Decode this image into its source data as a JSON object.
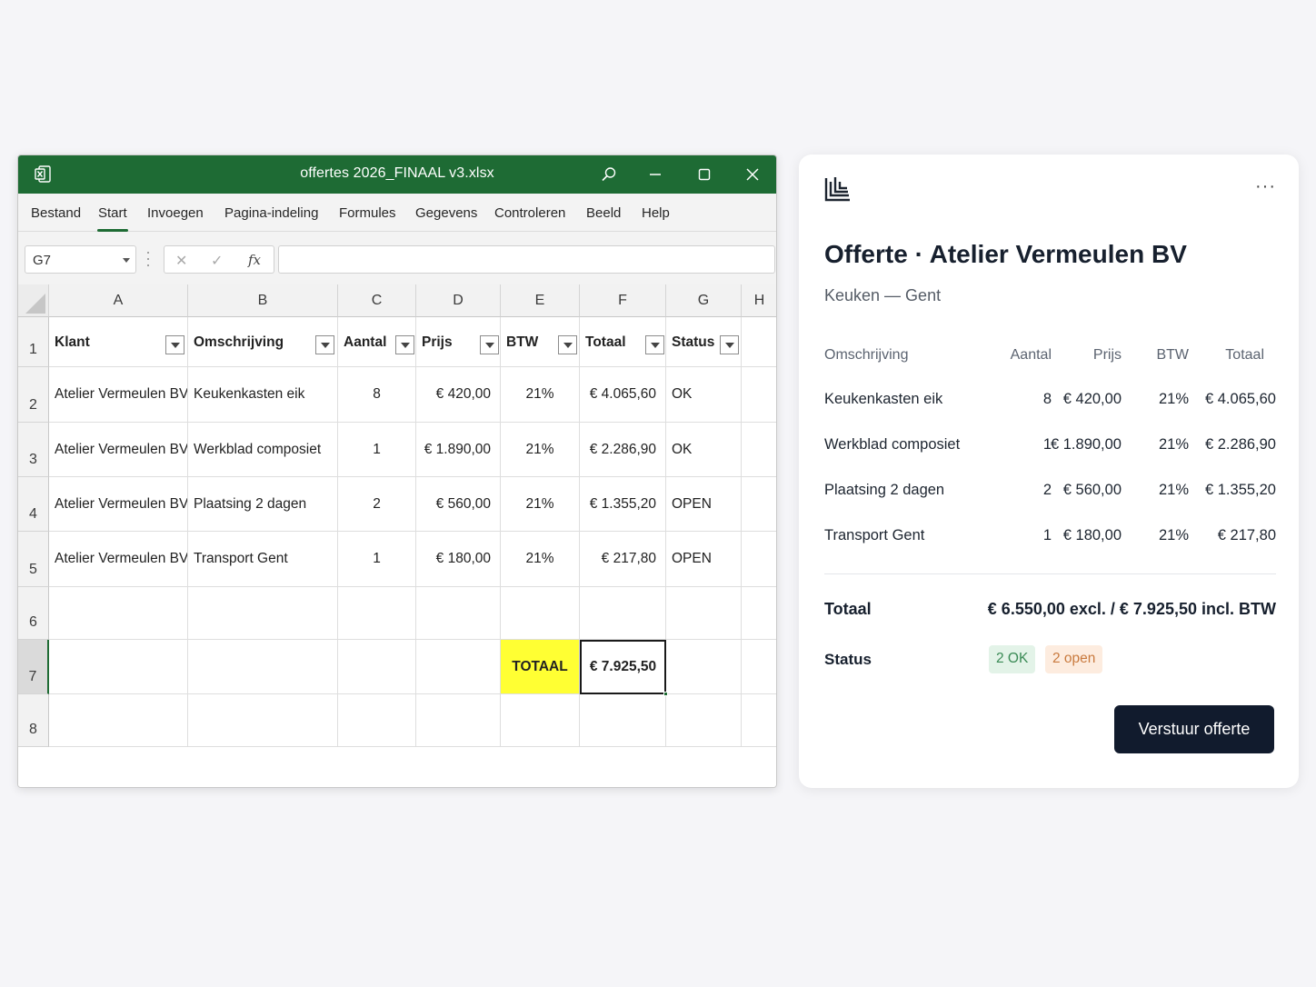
{
  "excel": {
    "title": "offertes 2026_FINAAL v3.xlsx",
    "icons": {
      "app": "excel-icon",
      "search": "search-icon",
      "minimize": "minimize-icon",
      "maximize": "maximize-icon",
      "close": "close-icon"
    },
    "menu": [
      "Bestand",
      "Start",
      "Invoegen",
      "Pagina-indeling",
      "Formules",
      "Gegevens",
      "Controleren",
      "Beeld",
      "Help"
    ],
    "active_menu": "Start",
    "name_box": "G7",
    "formula_icons": {
      "cancel": "✕",
      "enter": "✓",
      "fx": "fx"
    },
    "formula_value": "",
    "columns": [
      "A",
      "B",
      "C",
      "D",
      "E",
      "F",
      "G",
      "H"
    ],
    "rows": [
      "1",
      "2",
      "3",
      "4",
      "5",
      "6",
      "7",
      "8"
    ],
    "headers": [
      "Klant",
      "Omschrijving",
      "Aantal",
      "Prijs",
      "BTW",
      "Totaal",
      "Status"
    ],
    "data": [
      [
        "Atelier Vermeulen BV",
        "Keukenkasten eik",
        "8",
        "€ 420,00",
        "21%",
        "€ 4.065,60",
        "OK"
      ],
      [
        "Atelier Vermeulen BV",
        "Werkblad composiet",
        "1",
        "€ 1.890,00",
        "21%",
        "€ 2.286,90",
        "OK"
      ],
      [
        "Atelier Vermeulen BV",
        "Plaatsing 2 dagen",
        "2",
        "€ 560,00",
        "21%",
        "€ 1.355,20",
        "OPEN"
      ],
      [
        "Atelier Vermeulen BV",
        "Transport Gent",
        "1",
        "€ 180,00",
        "21%",
        "€ 217,80",
        "OPEN"
      ]
    ],
    "total_label": "TOTAAL",
    "total_value": "€ 7.925,50",
    "colors": {
      "titlebar": "#1e6b34",
      "highlight": "#ffff33"
    }
  },
  "panel": {
    "logo": "stacked-bars-logo-icon",
    "more": "···",
    "title": "Offerte · Atelier Vermeulen BV",
    "subtitle": "Keuken — Gent",
    "columns": [
      "Omschrijving",
      "Aantal",
      "Prijs",
      "BTW",
      "Totaal"
    ],
    "rows": [
      [
        "Keukenkasten eik",
        "8",
        "€ 420,00",
        "21%",
        "€ 4.065,60"
      ],
      [
        "Werkblad composiet",
        "1",
        "€ 1.890,00",
        "21%",
        "€ 2.286,90"
      ],
      [
        "Plaatsing 2 dagen",
        "2",
        "€ 560,00",
        "21%",
        "€ 1.355,20"
      ],
      [
        "Transport Gent",
        "1",
        "€ 180,00",
        "21%",
        "€ 217,80"
      ]
    ],
    "total_label": "Totaal",
    "total_value": "€ 6.550,00 excl. / € 7.925,50 incl. BTW",
    "status_label": "Status",
    "badge_ok": "2 OK",
    "badge_open": "2 open",
    "send_button": "Verstuur offerte",
    "colors": {
      "button": "#111b2d",
      "ok_badge": "#e3f3e8",
      "open_badge": "#fdecdf"
    }
  }
}
